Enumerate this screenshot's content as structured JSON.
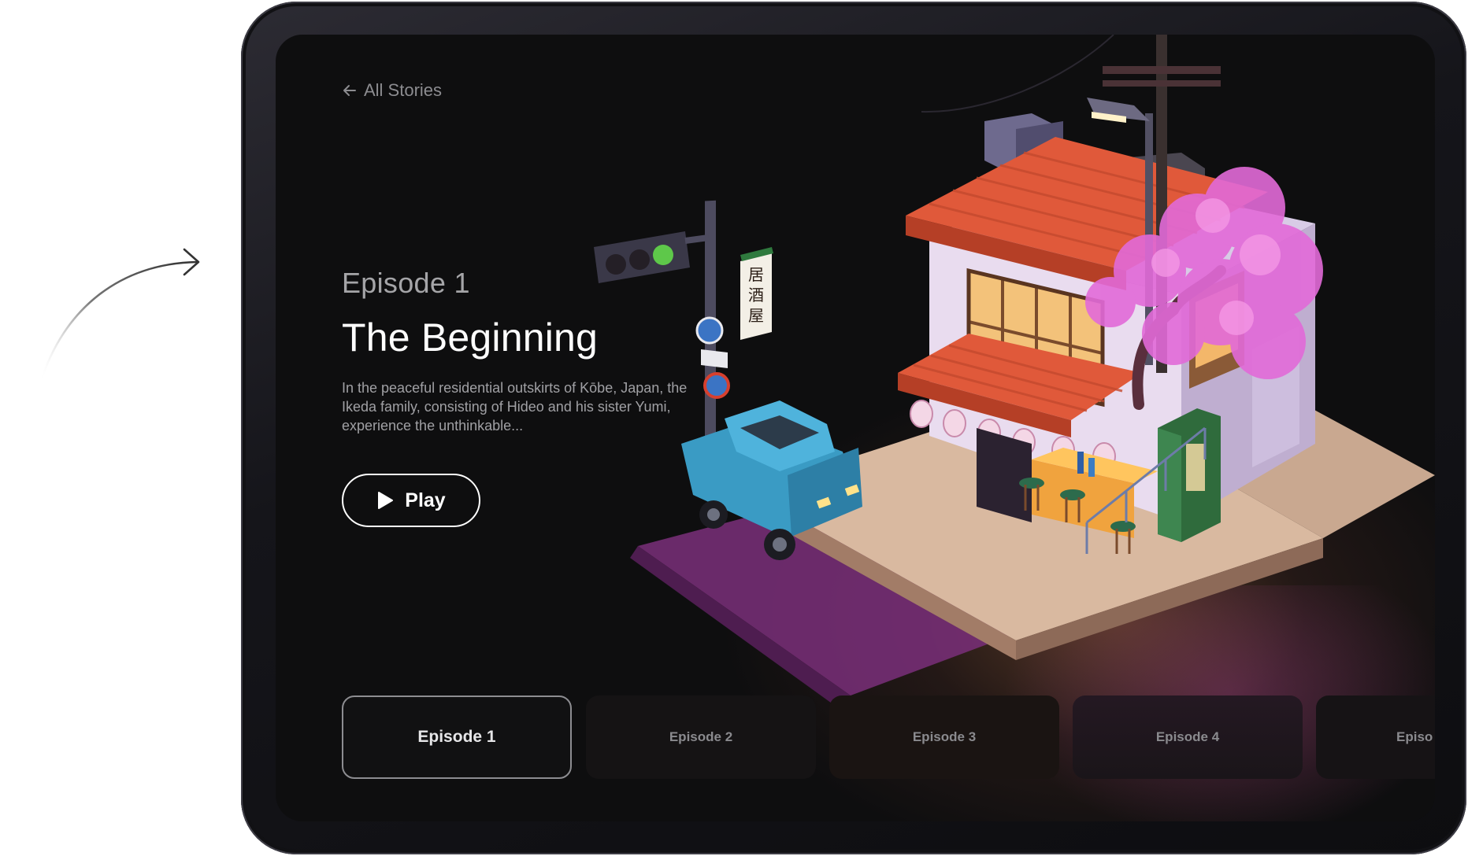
{
  "navigation": {
    "back_label": "All Stories",
    "back_icon": "arrow-left-icon"
  },
  "episode": {
    "number_label": "Episode 1",
    "title": "The Beginning",
    "description": "In the peaceful residential outskirts of Kōbe, Japan, the Ikeda family, consisting of Hideo and his sister Yumi, experience the unthinkable...",
    "play_label": "Play",
    "play_icon": "play-icon"
  },
  "episode_list": [
    {
      "label": "Episode 1",
      "active": true
    },
    {
      "label": "Episode 2",
      "active": false
    },
    {
      "label": "Episode 3",
      "active": false
    },
    {
      "label": "Episode 4",
      "active": false
    },
    {
      "label": "Episo",
      "active": false
    }
  ],
  "artwork": {
    "sign_text": "居酒屋",
    "description_icons": [
      "traffic-light-icon",
      "street-lamp-icon",
      "car-icon",
      "cherry-tree-icon"
    ]
  },
  "colors": {
    "screen_bg": "#0e0e0f",
    "accent_roof": "#e0593a",
    "accent_blossom": "#e26ad8",
    "car": "#3a9bc4"
  }
}
